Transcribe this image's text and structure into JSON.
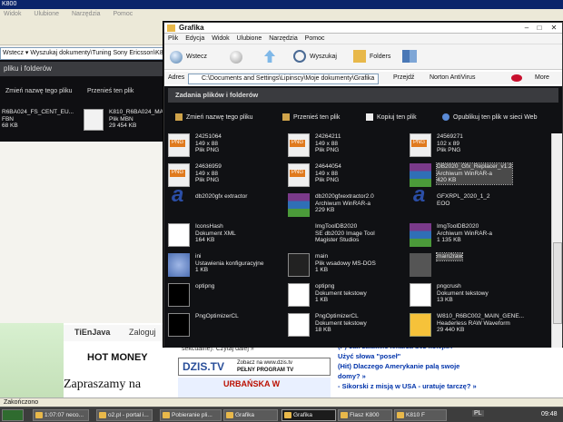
{
  "background_window": {
    "title": "K800",
    "menu": [
      "Widok",
      "Ulubione",
      "Narzędzia",
      "Pomoc"
    ],
    "address_text": "Wstecz ▾   Wyszukaj   dokumenty\\Tuning Sony Ericsson\\K800\\Flasz K800",
    "task_header": "pliku i folderów",
    "tasks": [
      "Zmień nazwę tego pliku",
      "Przenieś ten plik"
    ],
    "files": [
      {
        "name": "R6BA024_FS_CENT_EU...",
        "type": "FBN",
        "size": "68 KB"
      },
      {
        "name": "K810_R6BA024_MA...",
        "type": "Plik MBN",
        "size": "29 454 KB"
      }
    ]
  },
  "main_window": {
    "title": "Grafika",
    "menu": [
      "Plik",
      "Edycja",
      "Widok",
      "Ulubione",
      "Narzędzia",
      "Pomoc"
    ],
    "toolbar": {
      "back": "Wstecz",
      "search": "Wyszukaj",
      "folders": "Folders"
    },
    "address": {
      "label": "Adres",
      "value": "C:\\Documents and Settings\\Lipinscy\\Moje dokumenty\\Grafika",
      "go": "Przejdź",
      "norton": "Norton AntiVirus",
      "more": "More"
    },
    "tasks_header": "Zadania plików i folderów",
    "tasks": [
      "Zmień nazwę tego pliku",
      "Przenieś ten plik",
      "Kopiuj ten plik",
      "Opublikuj ten plik w sieci Web"
    ],
    "files": [
      {
        "name": "24251064",
        "line2": "149 x 88",
        "line3": "Plik PNG",
        "icon": "png"
      },
      {
        "name": "24264211",
        "line2": "149 x 88",
        "line3": "Plik PNG",
        "icon": "png"
      },
      {
        "name": "24569271",
        "line2": "102 x 89",
        "line3": "Plik PNG",
        "icon": "png"
      },
      {
        "name": "24636959",
        "line2": "149 x 88",
        "line3": "Plik PNG",
        "icon": "png"
      },
      {
        "name": "24644054",
        "line2": "149 x 88",
        "line3": "Plik PNG",
        "icon": "png"
      },
      {
        "name": "DB2020_Gfx_Replacer_v1.2",
        "line2": "Archiwum WinRAR-a",
        "line3": "420 KB",
        "icon": "rar",
        "selected": true
      },
      {
        "name": "db2020gfx extractor",
        "line2": "",
        "line3": "",
        "icon": "eoo"
      },
      {
        "name": "db2020gfxextractor2.0",
        "line2": "Archiwum WinRAR-a",
        "line3": "229 KB",
        "icon": "rar"
      },
      {
        "name": "GFXRPL_2020_1_2",
        "line2": "EOO",
        "line3": "",
        "icon": "eoo"
      },
      {
        "name": "IconsHash",
        "line2": "Dokument XML",
        "line3": "164 KB",
        "icon": "xml"
      },
      {
        "name": "ImgToolDB2020",
        "line2": "SE db2020 Image Tool",
        "line3": "Magister Studios",
        "icon": "img"
      },
      {
        "name": "ImgToolDB2020",
        "line2": "Archiwum WinRAR-a",
        "line3": "1 135 KB",
        "icon": "rar"
      },
      {
        "name": "ini",
        "line2": "Ustawienia konfiguracyjne",
        "line3": "1 KB",
        "icon": "ini"
      },
      {
        "name": "main",
        "line2": "Plik wsadowy MS-DOS",
        "line3": "1 KB",
        "icon": "bat"
      },
      {
        "name": "main2raw",
        "line2": "",
        "line3": "",
        "icon": "gry",
        "selected": true
      },
      {
        "name": "optipng",
        "line2": "",
        "line3": "",
        "icon": "blk"
      },
      {
        "name": "optipng",
        "line2": "Dokument tekstowy",
        "line3": "1 KB",
        "icon": "txt"
      },
      {
        "name": "pngcrush",
        "line2": "Dokument tekstowy",
        "line3": "13 KB",
        "icon": "txt"
      },
      {
        "name": "PngOptimizerCL",
        "line2": "",
        "line3": "",
        "icon": "blk"
      },
      {
        "name": "PngOptimizerCL",
        "line2": "Dokument tekstowy",
        "line3": "18 KB",
        "icon": "txt"
      },
      {
        "name": "W810_R6BC002_MAIN_GENE...",
        "line2": "Headerless RAW Waveform",
        "line3": "29 440 KB",
        "icon": "wav"
      }
    ]
  },
  "web": {
    "news": [
      "(P) Jak załatwić lekarza bez kolejki?",
      "Użyć słowa \"poseł\"",
      "(Hit) Dlaczego Amerykanie palą swoje",
      "domy? »",
      "- Sikorski z misją w USA - uratuje tarczę? »"
    ],
    "snippet": "sekcualne). Czytaj dalej »",
    "dzis_logo": "DZIS.TV",
    "dzis_text": "Zobacz na www.dzis.tv",
    "dzis_link": "PEŁNY PROGRAM TV",
    "hotmoney": "HOT MONEY",
    "zapraszamy": "Zapraszamy na",
    "urbanska": "URBAŃSKA W",
    "tiljava": "TiEnJava",
    "zaloguj": "Zaloguj"
  },
  "status_bar": "Zakończono",
  "taskbar": {
    "items": [
      "1:07:07 neco...",
      "o2.pl - portal i...",
      "Pobieranie pli...",
      "Grafika",
      "Grafika",
      "Flasz K800",
      "K810 F"
    ],
    "lang": "PL",
    "clock": "09:48"
  }
}
